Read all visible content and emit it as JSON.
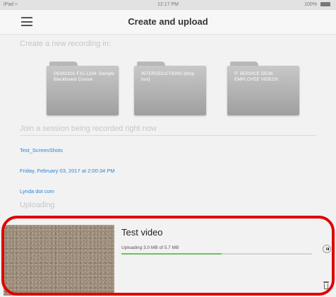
{
  "status_bar": {
    "carrier": "iPad",
    "time": "12:17 PM",
    "battery": "100%"
  },
  "nav": {
    "title": "Create and upload"
  },
  "create": {
    "header": "Create a new recording in:",
    "folders": [
      {
        "label": "DEMO101-F15-1234: Sample Blackboard Course"
      },
      {
        "label": "INTERODUCTIONS [drop box]"
      },
      {
        "label": "IT SERVICE DESK EMPLOYEE VIDEOS"
      }
    ]
  },
  "join": {
    "header": "Join a session being recorded right now",
    "sessions": [
      {
        "label": "Test_ScreenShots"
      },
      {
        "label": "Friday, February 03, 2017 at 2:00:34 PM"
      },
      {
        "label": "Lynda dot com"
      }
    ]
  },
  "uploading": {
    "header": "Uploading",
    "item": {
      "title": "Test video",
      "progress_text": "Uploading 3.0 MB of 5.7 MB",
      "progress_fraction": 0.526
    }
  },
  "colors": {
    "link": "#2f82d4",
    "progress": "#6cc25d",
    "highlight": "#e00000"
  },
  "icons": {
    "menu": "hamburger-menu-icon",
    "pause": "pause-icon",
    "delete": "trash-icon",
    "wifi": "wifi-icon",
    "battery": "battery-icon"
  }
}
